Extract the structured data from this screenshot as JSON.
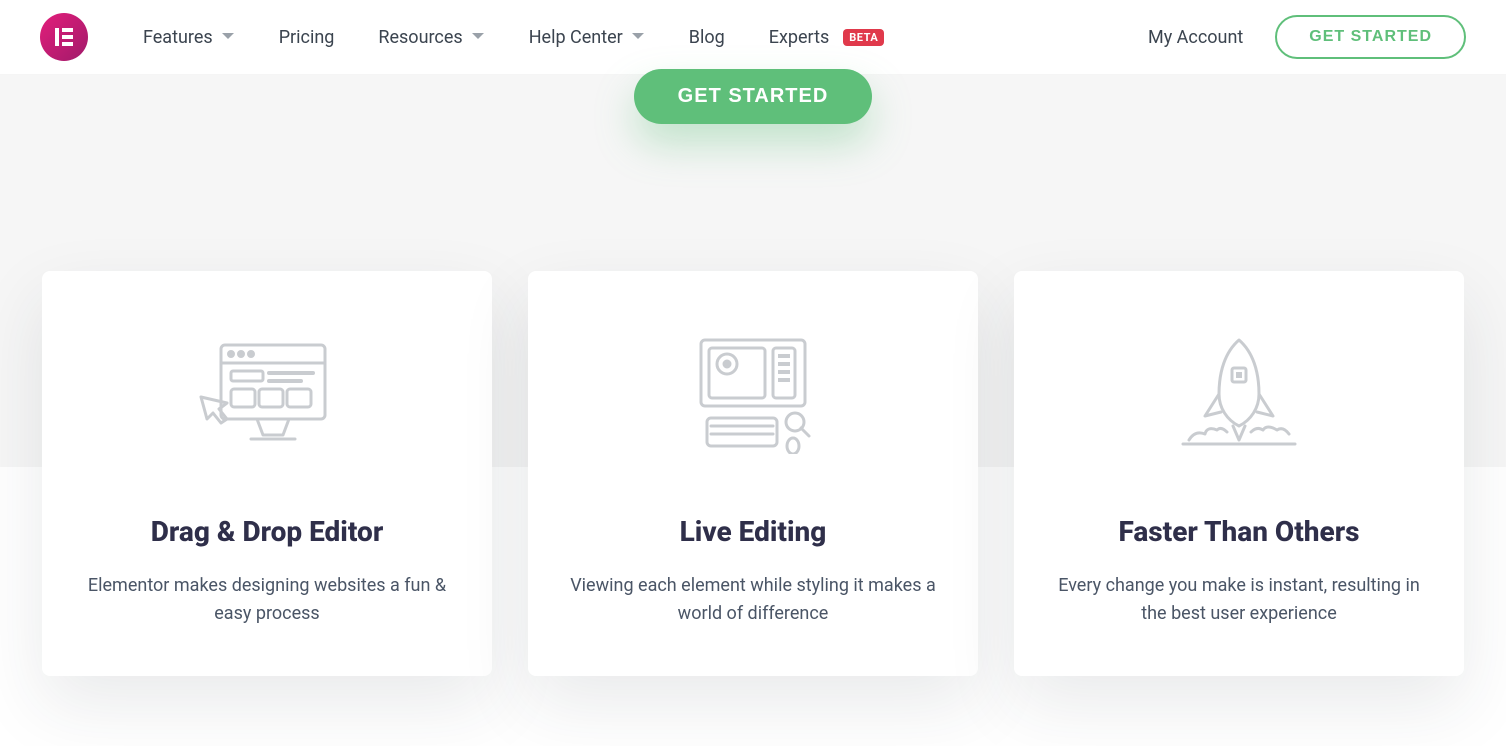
{
  "header": {
    "nav": {
      "features": "Features",
      "pricing": "Pricing",
      "resources": "Resources",
      "help_center": "Help Center",
      "blog": "Blog",
      "experts": "Experts",
      "experts_badge": "BETA"
    },
    "right": {
      "my_account": "My Account",
      "get_started": "GET STARTED"
    }
  },
  "hero": {
    "cta": "GET STARTED"
  },
  "cards": [
    {
      "title": "Drag & Drop Editor",
      "desc": "Elementor makes designing websites a fun & easy process"
    },
    {
      "title": "Live Editing",
      "desc": "Viewing each element while styling it makes a world of difference"
    },
    {
      "title": "Faster Than Others",
      "desc": "Every change you make is instant, resulting in the best user experience"
    }
  ]
}
